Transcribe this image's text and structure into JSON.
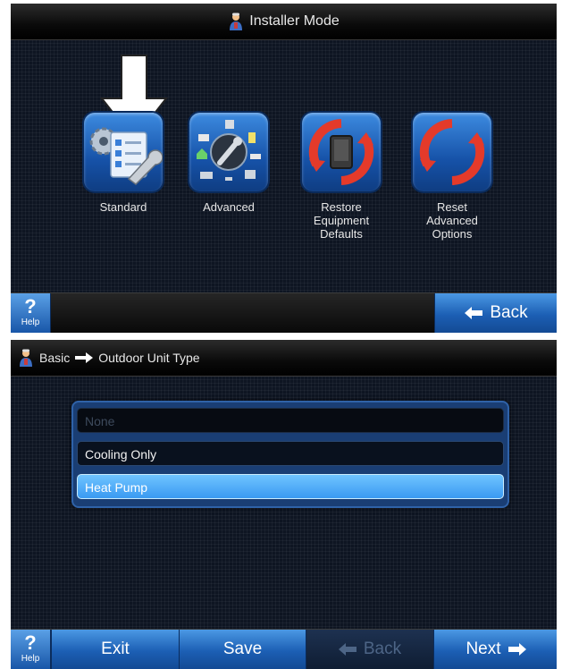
{
  "screen1": {
    "title": "Installer Mode",
    "icons": [
      {
        "label": "Standard"
      },
      {
        "label": "Advanced"
      },
      {
        "label": "Restore\nEquipment\nDefaults"
      },
      {
        "label": "Reset\nAdvanced\nOptions"
      }
    ],
    "help": {
      "symbol": "?",
      "label": "Help"
    },
    "back": "Back"
  },
  "screen2": {
    "breadcrumb": {
      "parent": "Basic",
      "current": "Outdoor Unit Type"
    },
    "options": [
      {
        "label": "None",
        "state": "disabled"
      },
      {
        "label": "Cooling Only",
        "state": "normal"
      },
      {
        "label": "Heat Pump",
        "state": "selected"
      }
    ],
    "help": {
      "symbol": "?",
      "label": "Help"
    },
    "buttons": {
      "exit": "Exit",
      "save": "Save",
      "back": "Back",
      "next": "Next"
    }
  }
}
